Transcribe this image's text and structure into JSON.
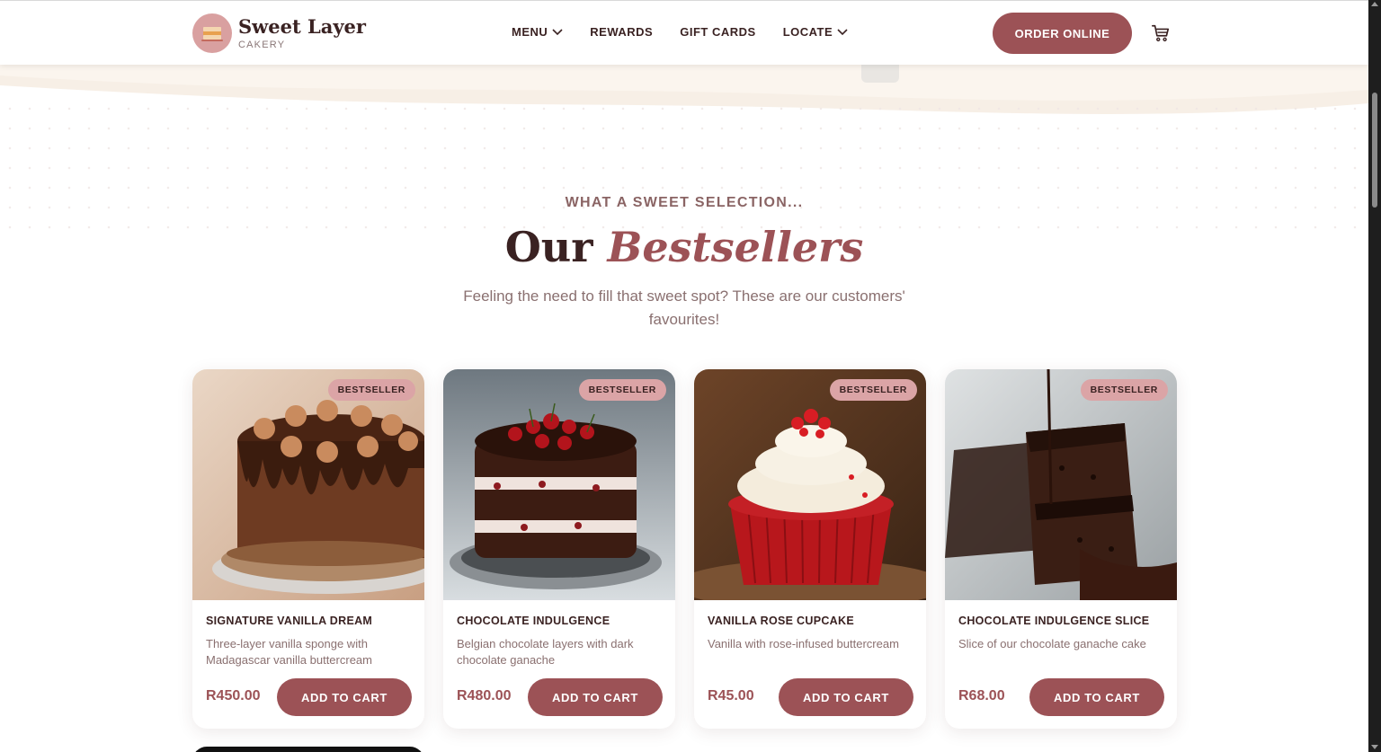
{
  "header": {
    "brand_name": "Sweet Layer",
    "brand_sub": "CAKERY",
    "nav": [
      {
        "label": "MENU",
        "has_dropdown": true
      },
      {
        "label": "REWARDS",
        "has_dropdown": false
      },
      {
        "label": "GIFT CARDS",
        "has_dropdown": false
      },
      {
        "label": "LOCATE",
        "has_dropdown": true
      }
    ],
    "order_button": "ORDER ONLINE",
    "cart_icon": "cart-icon"
  },
  "section": {
    "eyebrow": "WHAT A SWEET SELECTION...",
    "title_plain": "Our",
    "title_accent": "Bestsellers",
    "subtitle": "Feeling the need to fill that sweet spot? These are our customers' favourites!"
  },
  "products": [
    {
      "badge": "BESTSELLER",
      "name": "SIGNATURE VANILLA DREAM",
      "description": "Three-layer vanilla sponge with Madagascar vanilla buttercream",
      "price": "R450.00",
      "button": "ADD TO CART"
    },
    {
      "badge": "BESTSELLER",
      "name": "CHOCOLATE INDULGENCE",
      "description": "Belgian chocolate layers with dark chocolate ganache",
      "price": "R480.00",
      "button": "ADD TO CART"
    },
    {
      "badge": "BESTSELLER",
      "name": "VANILLA ROSE CUPCAKE",
      "description": "Vanilla with rose-infused buttercream",
      "price": "R45.00",
      "button": "ADD TO CART"
    },
    {
      "badge": "BESTSELLER",
      "name": "CHOCOLATE INDULGENCE SLICE",
      "description": "Slice of our chocolate ganache cake",
      "price": "R68.00",
      "button": "ADD TO CART"
    }
  ],
  "colors": {
    "accent": "#9c5256",
    "badge": "#dba4a6",
    "text_dark": "#3a2222",
    "text_muted": "#8a7070"
  }
}
